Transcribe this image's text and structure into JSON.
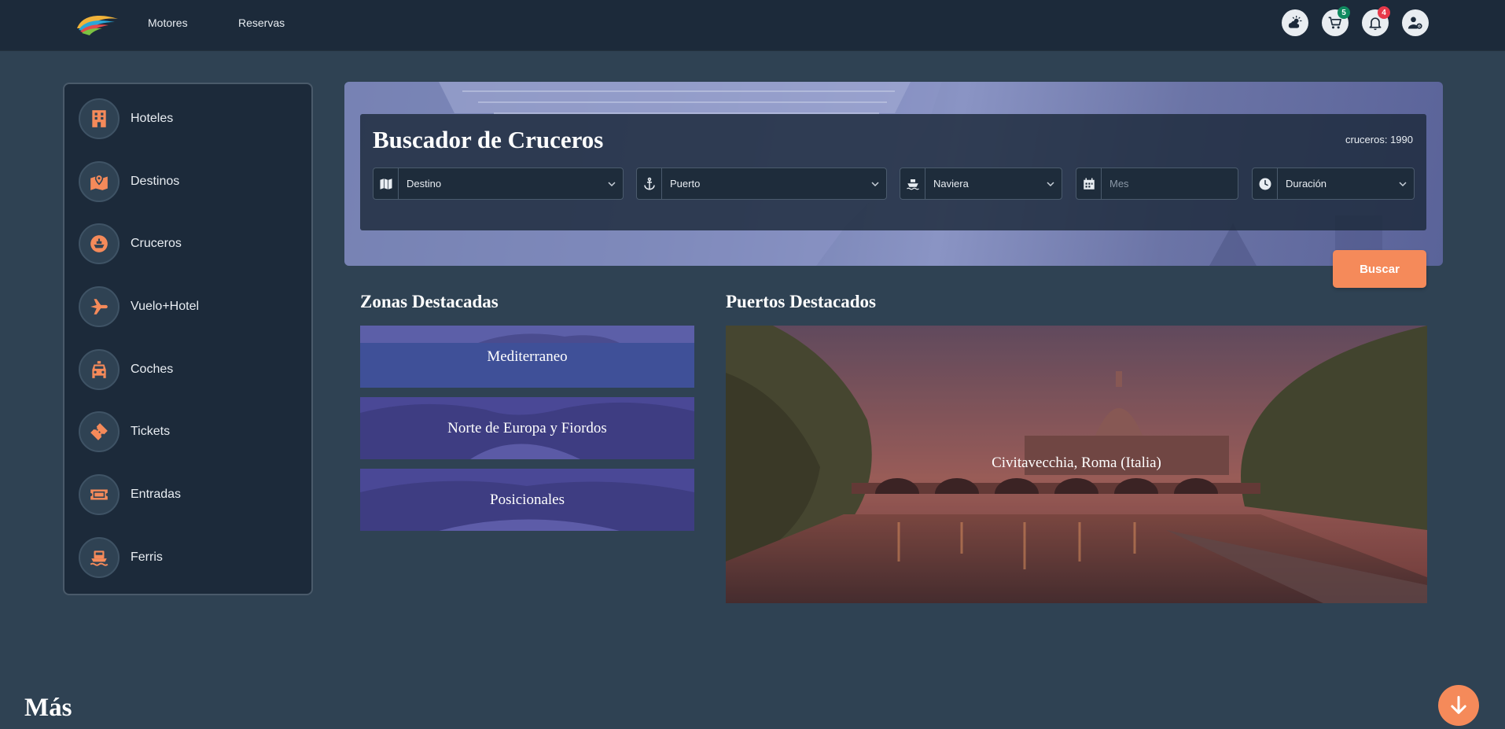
{
  "nav": {
    "links": [
      "Motores",
      "Reservas"
    ],
    "badges": {
      "cart": "5",
      "notifications": "4"
    },
    "icons": [
      "weather-icon",
      "cart-icon",
      "bell-icon",
      "user-settings-icon"
    ]
  },
  "sidebar": {
    "items": [
      {
        "label": "Hoteles",
        "icon": "hotel-icon"
      },
      {
        "label": "Destinos",
        "icon": "map-pin-icon"
      },
      {
        "label": "Cruceros",
        "icon": "ship-icon"
      },
      {
        "label": "Vuelo+Hotel",
        "icon": "plane-icon"
      },
      {
        "label": "Coches",
        "icon": "car-icon"
      },
      {
        "label": "Tickets",
        "icon": "ticket-icon"
      },
      {
        "label": "Entradas",
        "icon": "entry-ticket-icon"
      },
      {
        "label": "Ferris",
        "icon": "ferry-icon"
      }
    ]
  },
  "search": {
    "title": "Buscador de Cruceros",
    "count": "cruceros: 1990",
    "fields": {
      "destino": "Destino",
      "puerto": "Puerto",
      "naviera": "Naviera",
      "mes_placeholder": "Mes",
      "duracion": "Duración"
    },
    "button": "Buscar"
  },
  "zonas": {
    "title": "Zonas Destacadas",
    "items": [
      "Mediterraneo",
      "Norte de Europa y Fiordos",
      "Posicionales"
    ]
  },
  "puertos": {
    "title": "Puertos Destacados",
    "featured": "Civitavecchia, Roma (Italia)"
  },
  "footer": {
    "mas": "Más"
  },
  "colors": {
    "accent": "#f58a5a",
    "background": "#2f4253",
    "panel": "#1c2a3a",
    "zone_overlay": "#4b4a98"
  }
}
